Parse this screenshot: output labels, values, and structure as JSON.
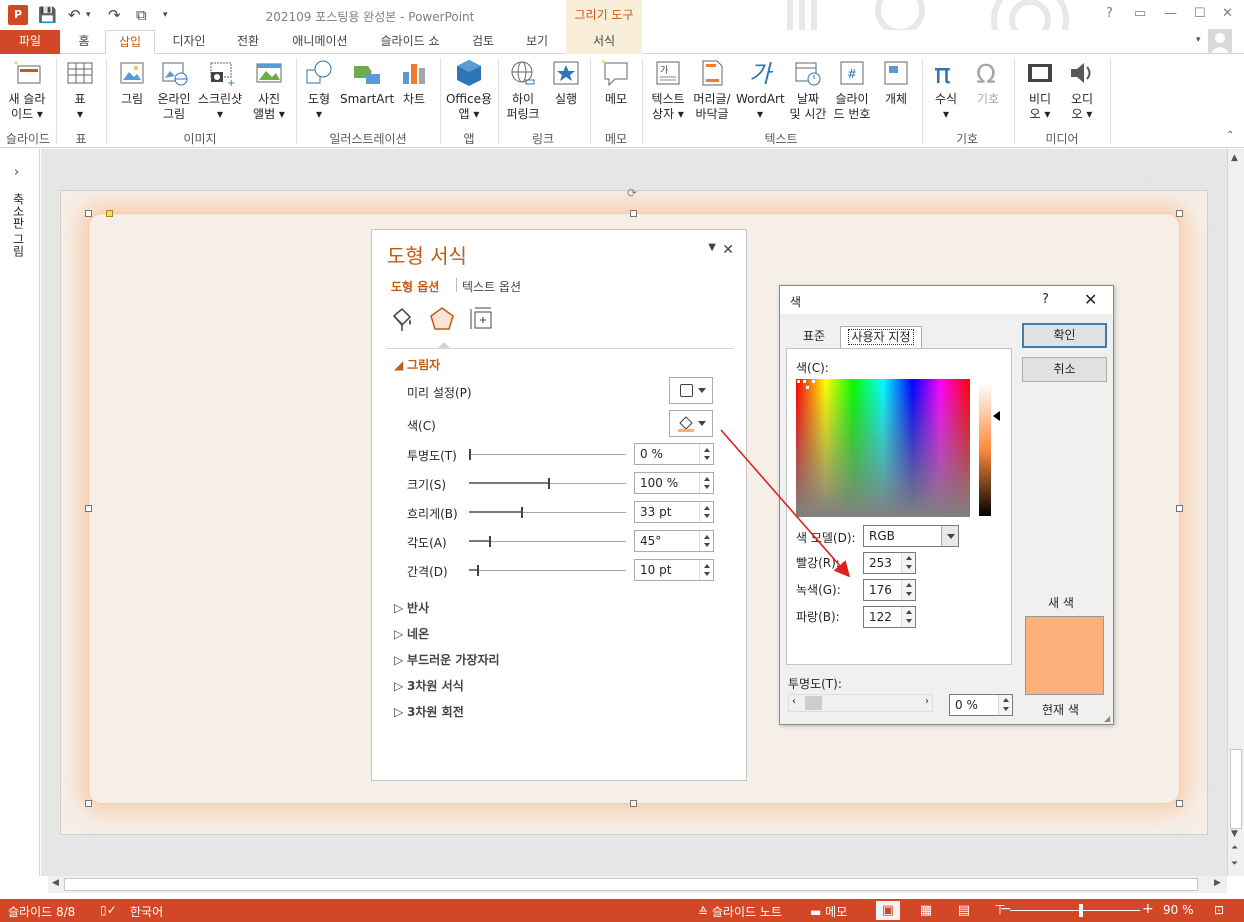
{
  "window": {
    "title": "202109 포스팅용 완성본 - PowerPoint",
    "contextual_tab_group": "그리기 도구",
    "help": "?"
  },
  "tabs": [
    "파일",
    "홈",
    "삽입",
    "디자인",
    "전환",
    "애니메이션",
    "슬라이드 쇼",
    "검토",
    "보기",
    "서식"
  ],
  "active_tab": "삽입",
  "ribbon": {
    "groups": [
      {
        "label": "슬라이드",
        "buttons": [
          "새 슬라\n이드 ▾"
        ]
      },
      {
        "label": "표",
        "buttons": [
          "표\n▾"
        ]
      },
      {
        "label": "이미지",
        "buttons": [
          "그림",
          "온라인\n그림",
          "스크린샷\n▾",
          "사진\n앨범 ▾"
        ]
      },
      {
        "label": "일러스트레이션",
        "buttons": [
          "도형\n▾",
          "SmartArt",
          "차트"
        ]
      },
      {
        "label": "앱",
        "buttons": [
          "Office용\n앱 ▾"
        ]
      },
      {
        "label": "링크",
        "buttons": [
          "하이\n퍼링크",
          "실행"
        ]
      },
      {
        "label": "메모",
        "buttons": [
          "메모"
        ]
      },
      {
        "label": "텍스트",
        "buttons": [
          "텍스트\n상자 ▾",
          "머리글/\n바닥글",
          "WordArt\n▾",
          "날짜\n및 시간",
          "슬라이\n드 번호",
          "개체"
        ]
      },
      {
        "label": "기호",
        "buttons": [
          "수식\n▾",
          "기호"
        ]
      },
      {
        "label": "미디어",
        "buttons": [
          "비디\n오 ▾",
          "오디\n오 ▾"
        ]
      }
    ]
  },
  "left_pane": {
    "label": "축소판 그림"
  },
  "format_pane": {
    "title": "도형 서식",
    "tab_shape": "도형 옵션",
    "tab_text": "텍스트 옵션",
    "shadow_section": "그림자",
    "props": {
      "preset": "미리 설정(P)",
      "color": "색(C)",
      "transparency": {
        "label": "투명도(T)",
        "value": "0 %",
        "level": 0
      },
      "size": {
        "label": "크기(S)",
        "value": "100 %",
        "level": 0.5
      },
      "blur": {
        "label": "흐리게(B)",
        "value": "33 pt",
        "level": 0.33
      },
      "angle": {
        "label": "각도(A)",
        "value": "45°",
        "level": 0.125
      },
      "distance": {
        "label": "간격(D)",
        "value": "10 pt",
        "level": 0.05
      }
    },
    "sections": [
      "반사",
      "네온",
      "부드러운 가장자리",
      "3차원 서식",
      "3차원 회전"
    ]
  },
  "color_dialog": {
    "title": "색",
    "help": "?",
    "tab_standard": "표준",
    "tab_custom": "사용자 지정",
    "colors_label": "색(C):",
    "color_model_label": "색 모델(D):",
    "color_model": "RGB",
    "red_label": "빨강(R):",
    "red": "253",
    "green_label": "녹색(G):",
    "green": "176",
    "blue_label": "파랑(B):",
    "blue": "122",
    "ok": "확인",
    "cancel": "취소",
    "new_label": "새 색",
    "current_label": "현재 색",
    "transparency_label": "투명도(T):",
    "transparency": "0 %",
    "new_color_hex": "#fdb07a"
  },
  "statusbar": {
    "slide": "슬라이드 8/8",
    "language": "한국어",
    "notes": "슬라이드 노트",
    "comments": "메모",
    "zoom": "90 %"
  },
  "colors": {
    "accent": "#d24726",
    "selected_tab_text": "#c55a11",
    "shadow_color": "#fdb07a",
    "annotation_arrow": "#e02020"
  }
}
